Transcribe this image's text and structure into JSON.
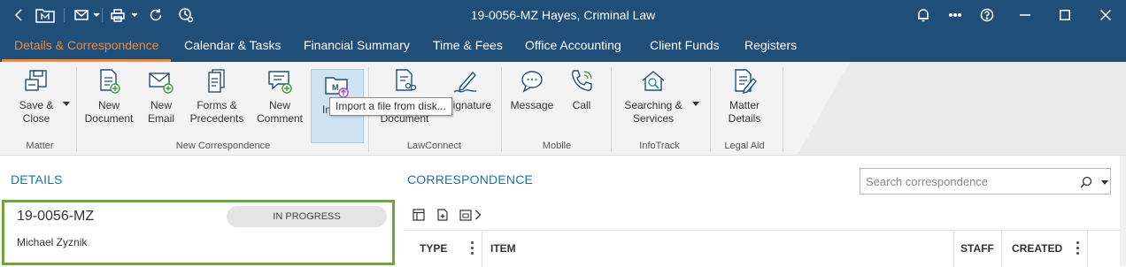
{
  "window": {
    "title": "19-0056-MZ Hayes, Criminal Law"
  },
  "tabs": [
    {
      "label": "Details & Correspondence",
      "active": true
    },
    {
      "label": "Calendar & Tasks"
    },
    {
      "label": "Financial Summary"
    },
    {
      "label": "Time & Fees"
    },
    {
      "label": "Office Accounting"
    },
    {
      "label": "Client Funds"
    },
    {
      "label": "Registers"
    }
  ],
  "ribbon": {
    "buttons": {
      "save_close": "Save &\nClose",
      "new_document": "New\nDocument",
      "new_email": "New\nEmail",
      "forms_precedents": "Forms &\nPrecedents",
      "new_comment": "New\nComment",
      "import": "Import",
      "share_document": "Share\nDocument",
      "esignature": "eSignature",
      "message": "Message",
      "call": "Call",
      "searching_services": "Searching &\nServices",
      "matter_details": "Matter\nDetails"
    },
    "groups": {
      "matter": "Matter",
      "new_correspondence": "New Correspondence",
      "lawconnect": "LawConnect",
      "mobile": "Mobile",
      "infotrack": "InfoTrack",
      "legal_aid": "Legal Aid"
    },
    "tooltip": "Import a file from disk..."
  },
  "details": {
    "title": "DETAILS",
    "matter_number": "19-0056-MZ",
    "status": "IN PROGRESS",
    "client": "Michael Zyznik"
  },
  "correspondence": {
    "title": "CORRESPONDENCE",
    "search_placeholder": "Search correspondence",
    "columns": [
      "TYPE",
      "ITEM",
      "STAFF",
      "CREATED"
    ]
  },
  "colors": {
    "titlebar": "#1f4e79",
    "active_tab": "#f08a3c",
    "accent_blue": "#1e6fb6",
    "card_border": "#6aa936"
  }
}
